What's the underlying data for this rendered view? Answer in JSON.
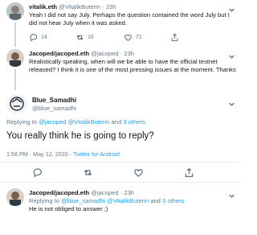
{
  "tweets": [
    {
      "name": "vitalik.eth",
      "handle": "@VitalikButerin",
      "sep": "·",
      "time": "23h",
      "text": [
        "Yeah I did not say July. Perhaps the question contained the word July but I",
        "did not hear July when it was asked."
      ],
      "replies": "14",
      "retweets": "16",
      "likes": "71"
    },
    {
      "name": "Jacoped/jacoped.eth",
      "handle": "@jacoped",
      "sep": "·",
      "time": "23h",
      "text": [
        "Realistically speaking, when will we be able to have the official testnet",
        "released? I think it is one of the most pressing issues at the moment. Thanks"
      ],
      "replies": "",
      "retweets": "",
      "likes": ""
    }
  ],
  "main": {
    "name": "Blue_Samadhi",
    "handle": "@blue_samadhi",
    "replying_prefix": "Replying to ",
    "replying_mention1": "@jacoped",
    "replying_mention2": "@VitalikButerin",
    "replying_and": " and ",
    "replying_others": "3 others",
    "text": "You really think he is going to reply?",
    "timestamp": "1:56 PM · May 12, 2020 · ",
    "source": "Twitter for Android"
  },
  "reply": {
    "name": "Jacoped/jacoped.eth",
    "handle": "@jacoped",
    "sep": "·",
    "time": "23h",
    "replying_prefix": "Replying to ",
    "replying_mention1": "@blue_samadhi",
    "replying_mention2": "@VitalikButerin",
    "replying_and": " and ",
    "replying_others": "3 others",
    "text": "He is not obliged to answer ;)"
  },
  "colors": {
    "accent": "#1da1f2",
    "muted": "#657786",
    "divider": "#e6ecf0"
  },
  "icons": [
    "reply-icon",
    "retweet-icon",
    "like-icon",
    "share-icon",
    "chevron-down-icon"
  ]
}
